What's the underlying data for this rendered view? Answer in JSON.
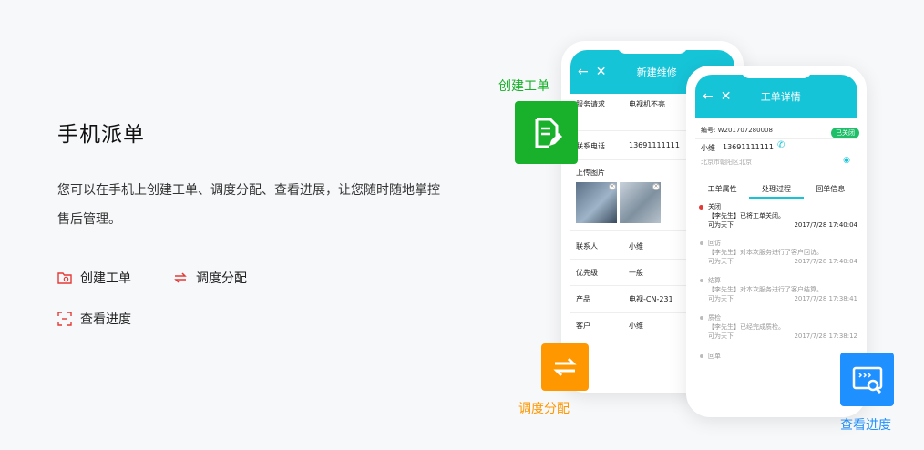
{
  "intro": {
    "title": "手机派单",
    "description": "您可以在手机上创建工单、调度分配、查看进展，让您随时随地掌控售后管理。",
    "features": [
      {
        "label": "创建工单",
        "icon": "folder-plus-icon"
      },
      {
        "label": "调度分配",
        "icon": "swap-arrows-icon"
      },
      {
        "label": "查看进度",
        "icon": "scan-icon"
      }
    ]
  },
  "badges": {
    "create": {
      "label": "创建工单",
      "color": "#19b12b",
      "icon": "document-edit-icon"
    },
    "dispatch": {
      "label": "调度分配",
      "color": "#ff9800",
      "icon": "swap-arrows-icon"
    },
    "progress": {
      "label": "查看进度",
      "color": "#1e90ff",
      "icon": "search-screen-icon"
    }
  },
  "phone_new": {
    "title": "新建维修",
    "fields": [
      {
        "key": "服务请求",
        "value": "电视机不亮"
      },
      {
        "key": "联系电话",
        "value": "13691111111"
      },
      {
        "key": "上传图片",
        "value": ""
      },
      {
        "key": "联系人",
        "value": "小维"
      },
      {
        "key": "优先级",
        "value": "一般"
      },
      {
        "key": "产品",
        "value": "电视-CN-231"
      },
      {
        "key": "客户",
        "value": "小维"
      }
    ]
  },
  "phone_detail": {
    "title": "工单详情",
    "number": "编号: W201707280008",
    "status": "已关闭",
    "contact_name": "小维",
    "contact_phone": "13691111111",
    "address": "北京市朝阳区北京",
    "tabs": [
      "工单属性",
      "处理过程",
      "回单信息"
    ],
    "timeline": [
      {
        "title": "关闭",
        "text": "【李先生】已将工单关闭。",
        "by": "可为天下",
        "time": "2017/7/28 17:40:04"
      },
      {
        "title": "回访",
        "text": "【李先生】对本次服务进行了客户回访。",
        "by": "可为天下",
        "time": "2017/7/28 17:40:04"
      },
      {
        "title": "结算",
        "text": "【李先生】对本次服务进行了客户结算。",
        "by": "可为天下",
        "time": "2017/7/28 17:38:41"
      },
      {
        "title": "质检",
        "text": "【李先生】已经完成质检。",
        "by": "可为天下",
        "time": "2017/7/28 17:38:12"
      },
      {
        "title": "回单",
        "text": "",
        "by": "",
        "time": ""
      }
    ]
  }
}
